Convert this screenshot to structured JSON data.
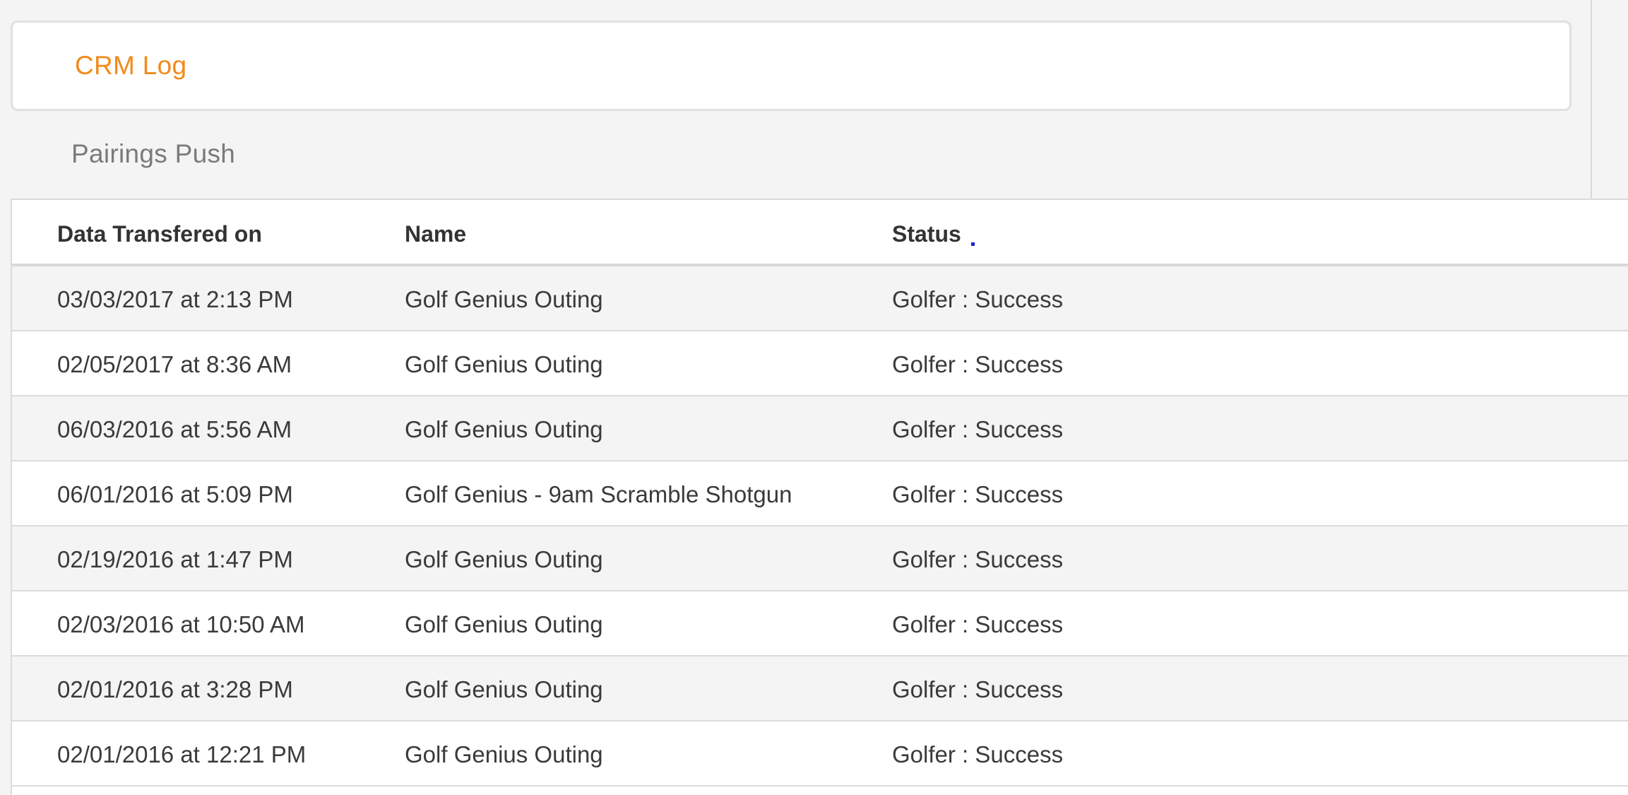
{
  "crm_log": {
    "title": "CRM Log"
  },
  "section": {
    "title": "Pairings Push"
  },
  "table": {
    "headers": [
      "Data Transfered on",
      "Name",
      "Status"
    ],
    "rows": [
      [
        "03/03/2017 at 2:13 PM",
        "Golf Genius Outing",
        "Golfer : Success"
      ],
      [
        "02/05/2017 at 8:36 AM",
        "Golf Genius Outing",
        "Golfer : Success"
      ],
      [
        "06/03/2016 at 5:56 AM",
        "Golf Genius Outing",
        "Golfer : Success"
      ],
      [
        "06/01/2016 at 5:09 PM",
        "Golf Genius - 9am Scramble Shotgun",
        "Golfer : Success"
      ],
      [
        "02/19/2016 at 1:47 PM",
        "Golf Genius Outing",
        "Golfer : Success"
      ],
      [
        "02/03/2016 at 10:50 AM",
        "Golf Genius Outing",
        "Golfer : Success"
      ],
      [
        "02/01/2016 at 3:28 PM",
        "Golf Genius Outing",
        "Golfer : Success"
      ],
      [
        "02/01/2016 at 12:21 PM",
        "Golf Genius Outing",
        "Golfer : Success"
      ]
    ]
  },
  "colors": {
    "accent": "#f28a1c",
    "row_alt": "#f4f4f4",
    "border": "#dcdcdc"
  }
}
